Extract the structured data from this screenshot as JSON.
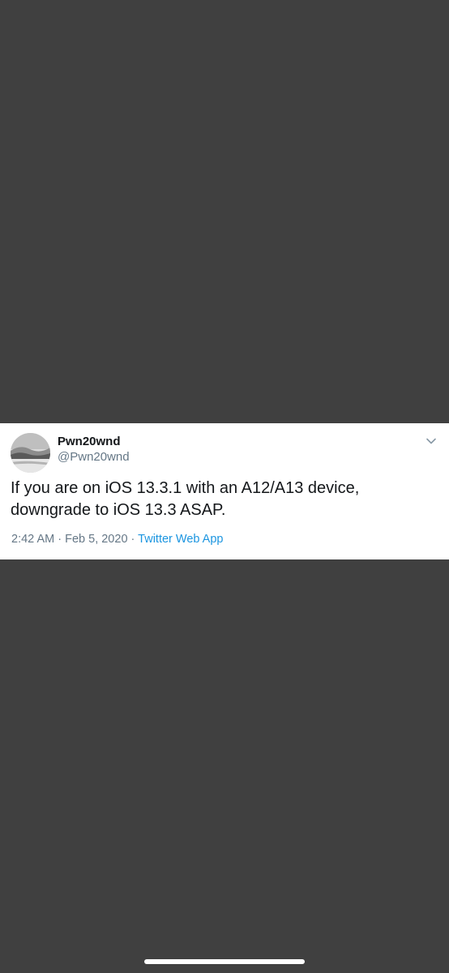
{
  "tweet": {
    "display_name": "Pwn20wnd",
    "handle": "@Pwn20wnd",
    "text": "If you are on iOS 13.3.1 with an A12/A13 device, downgrade to iOS 13.3 ASAP.",
    "time": "2:42 AM",
    "separator": "·",
    "date": "Feb 5, 2020",
    "source": "Twitter Web App",
    "menu_icon": "chevron-down-icon",
    "avatar": "profile-avatar-landscape"
  },
  "colors": {
    "background": "#404040",
    "card": "#ffffff",
    "text": "#14171a",
    "secondary": "#657786",
    "link": "#1b95e0"
  }
}
